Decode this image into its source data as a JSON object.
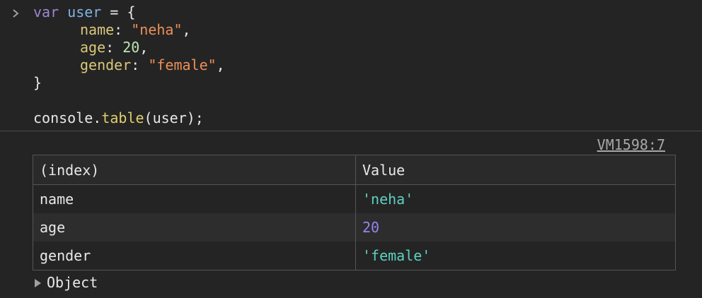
{
  "code": {
    "line1": {
      "kw": "var",
      "name": "user",
      "rest": " = {"
    },
    "line2": {
      "prop": "name",
      "sep": ": ",
      "value": "\"neha\"",
      "end": ","
    },
    "line3": {
      "prop": "age",
      "sep": ": ",
      "value": "20",
      "end": ","
    },
    "line4": {
      "prop": "gender",
      "sep": ": ",
      "value": "\"female\"",
      "end": ","
    },
    "line5": "}",
    "line7": {
      "obj": "console.",
      "fn": "table",
      "args": "(user);"
    }
  },
  "output": {
    "source_link": "VM1598:7",
    "table": {
      "headers": [
        "(index)",
        "Value"
      ],
      "rows": [
        {
          "index": "name",
          "value": "'neha'"
        },
        {
          "index": "age",
          "value": "20"
        },
        {
          "index": "gender",
          "value": "'female'"
        }
      ]
    },
    "object_label": "Object"
  },
  "colors": {
    "background": "#242424",
    "keyword": "#9c86d2",
    "string_value": "#5ed1c1",
    "number_value": "#9a83f0"
  },
  "icons": [
    "chevron-right-icon",
    "expand-triangle-icon"
  ]
}
